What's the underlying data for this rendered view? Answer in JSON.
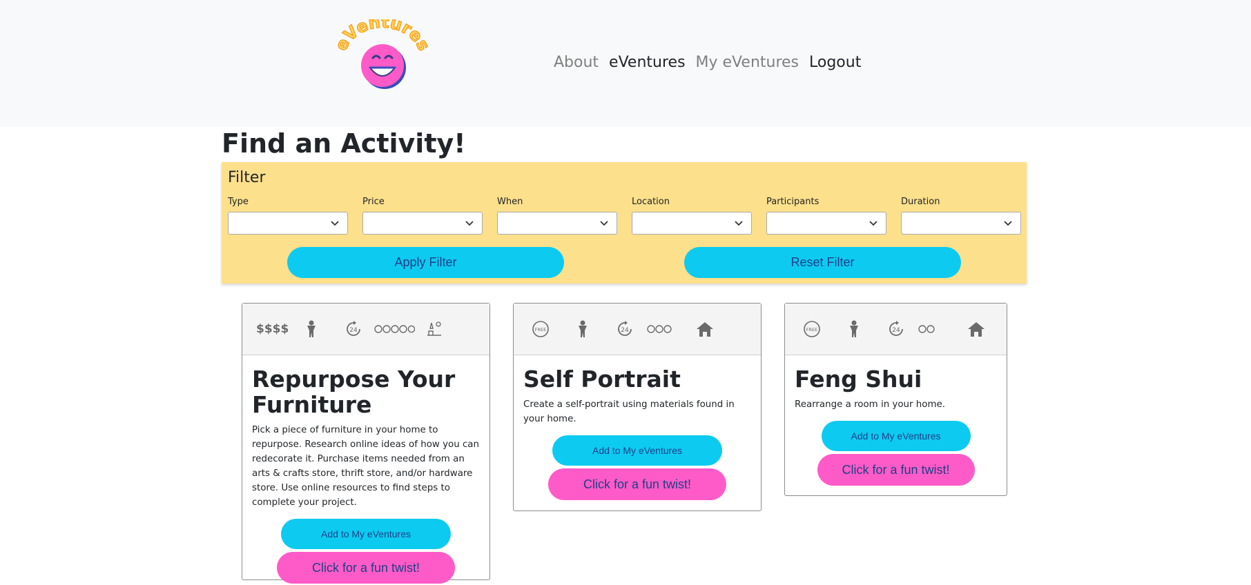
{
  "nav": {
    "logo_text": "eVentures",
    "links": [
      "About",
      "eVentures",
      "My eVentures",
      "Logout"
    ]
  },
  "page": {
    "title": "Find an Activity!"
  },
  "filter": {
    "title": "Filter",
    "fields": [
      {
        "label": "Type",
        "value": ""
      },
      {
        "label": "Price",
        "value": ""
      },
      {
        "label": "When",
        "value": ""
      },
      {
        "label": "Location",
        "value": ""
      },
      {
        "label": "Participants",
        "value": ""
      },
      {
        "label": "Duration",
        "value": ""
      }
    ],
    "apply_label": "Apply Filter",
    "reset_label": "Reset Filter"
  },
  "cards": [
    {
      "title": "Repurpose Your Furniture",
      "description": "Pick a piece of furniture in your home to repurpose. Research online ideas of how you can redecorate it. Purchase items needed from an arts & crafts store, thrift store, and/or hardware store. Use online resources to find steps to complete your project.",
      "price_text": "$$$$",
      "icons": [
        "price-icon",
        "person-icon",
        "24-hour-clock-icon",
        "duration-clocks-icon",
        "outdoor-icon"
      ],
      "add_label": "Add to My eVentures",
      "twist_label": "Click for a fun twist!"
    },
    {
      "title": "Self Portrait",
      "description": "Create a self-portrait using materials found in your home.",
      "price_text": "FREE",
      "icons": [
        "free-icon",
        "person-icon",
        "24-hour-clock-icon",
        "duration-clocks-icon",
        "home-icon"
      ],
      "add_label": "Add to My eVentures",
      "twist_label": "Click for a fun twist!"
    },
    {
      "title": "Feng Shui",
      "description": "Rearrange a room in your home.",
      "price_text": "FREE",
      "icons": [
        "free-icon",
        "person-icon",
        "24-hour-clock-icon",
        "duration-clocks-icon",
        "home-icon"
      ],
      "add_label": "Add to My eVentures",
      "twist_label": "Click for a fun twist!"
    }
  ],
  "colors": {
    "navbar_bg": "#f8f9fa",
    "filter_bg": "#fde08b",
    "primary_button": "#0dcaf0",
    "twist_button": "#ff5bc8",
    "button_text": "#1d3f87",
    "logo_face": "#ff5bc8",
    "logo_text": "#f5a623"
  }
}
